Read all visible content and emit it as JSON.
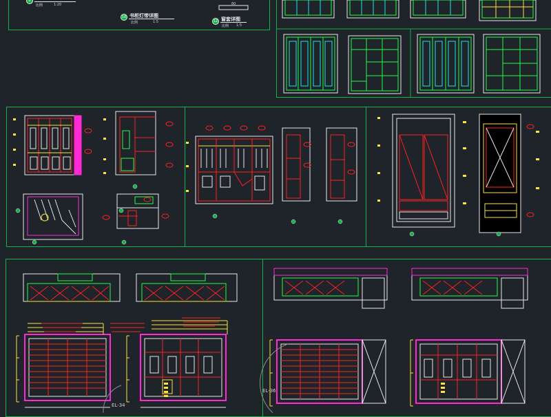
{
  "top_row": {
    "left_sheet": {
      "partial_label": "比例",
      "partial_scale": "1:20",
      "partial_number": "8"
    },
    "detail_1": {
      "number": "10",
      "title": "书柜灯带详图",
      "scale_label": "比例",
      "scale": "1:5"
    },
    "detail_2": {
      "number": "12",
      "title": "窗套详图",
      "scale_label": "比例",
      "scale": "1:5"
    },
    "dimension": "80"
  },
  "tags": {
    "elevation_a": "EL-34",
    "elevation_b": "EL-36"
  },
  "colors": {
    "background": "#1f232a",
    "frame": "#13b24a",
    "red": "#ff2020",
    "yellow": "#ffe23a",
    "magenta": "#ff2ad4",
    "white": "#e8e8e8",
    "green": "#22ff44",
    "cyan": "#1ee6e6"
  }
}
